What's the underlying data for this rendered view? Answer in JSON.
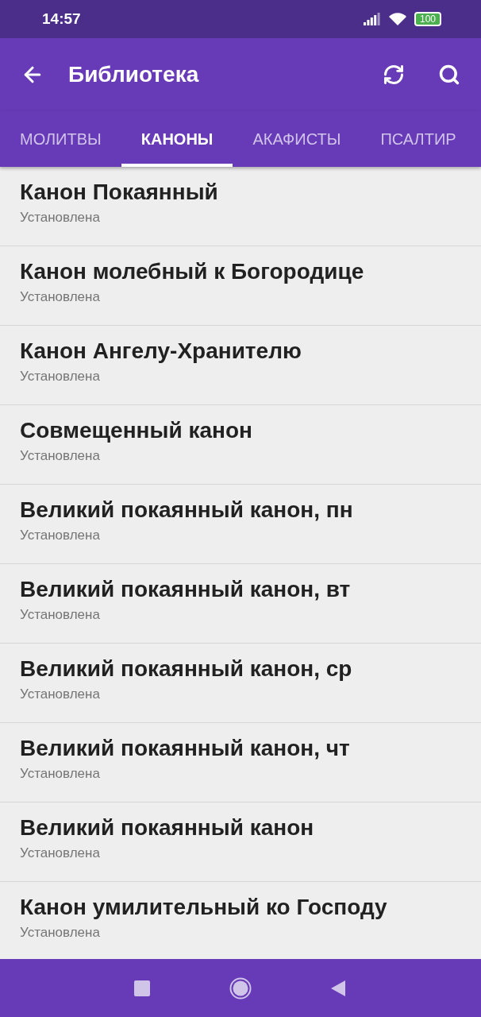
{
  "status_bar": {
    "time": "14:57",
    "battery": "100"
  },
  "app_bar": {
    "title": "Библиотека"
  },
  "tabs": [
    {
      "label": "МОЛИТВЫ",
      "selected": false
    },
    {
      "label": "КАНОНЫ",
      "selected": true
    },
    {
      "label": "АКАФИСТЫ",
      "selected": false
    },
    {
      "label": "ПСАЛТИР",
      "selected": false
    }
  ],
  "items": [
    {
      "title": "Канон Покаянный",
      "status": "Установлена"
    },
    {
      "title": "Канон молебный к Богородице",
      "status": "Установлена"
    },
    {
      "title": "Канон Ангелу-Хранителю",
      "status": "Установлена"
    },
    {
      "title": "Совмещенный канон",
      "status": "Установлена"
    },
    {
      "title": "Великий покаянный канон, пн",
      "status": "Установлена"
    },
    {
      "title": "Великий покаянный канон, вт",
      "status": "Установлена"
    },
    {
      "title": "Великий покаянный канон, ср",
      "status": "Установлена"
    },
    {
      "title": "Великий покаянный канон, чт",
      "status": "Установлена"
    },
    {
      "title": "Великий покаянный канон",
      "status": "Установлена"
    },
    {
      "title": "Канон умилительный ко Господу",
      "status": "Установлена"
    }
  ]
}
